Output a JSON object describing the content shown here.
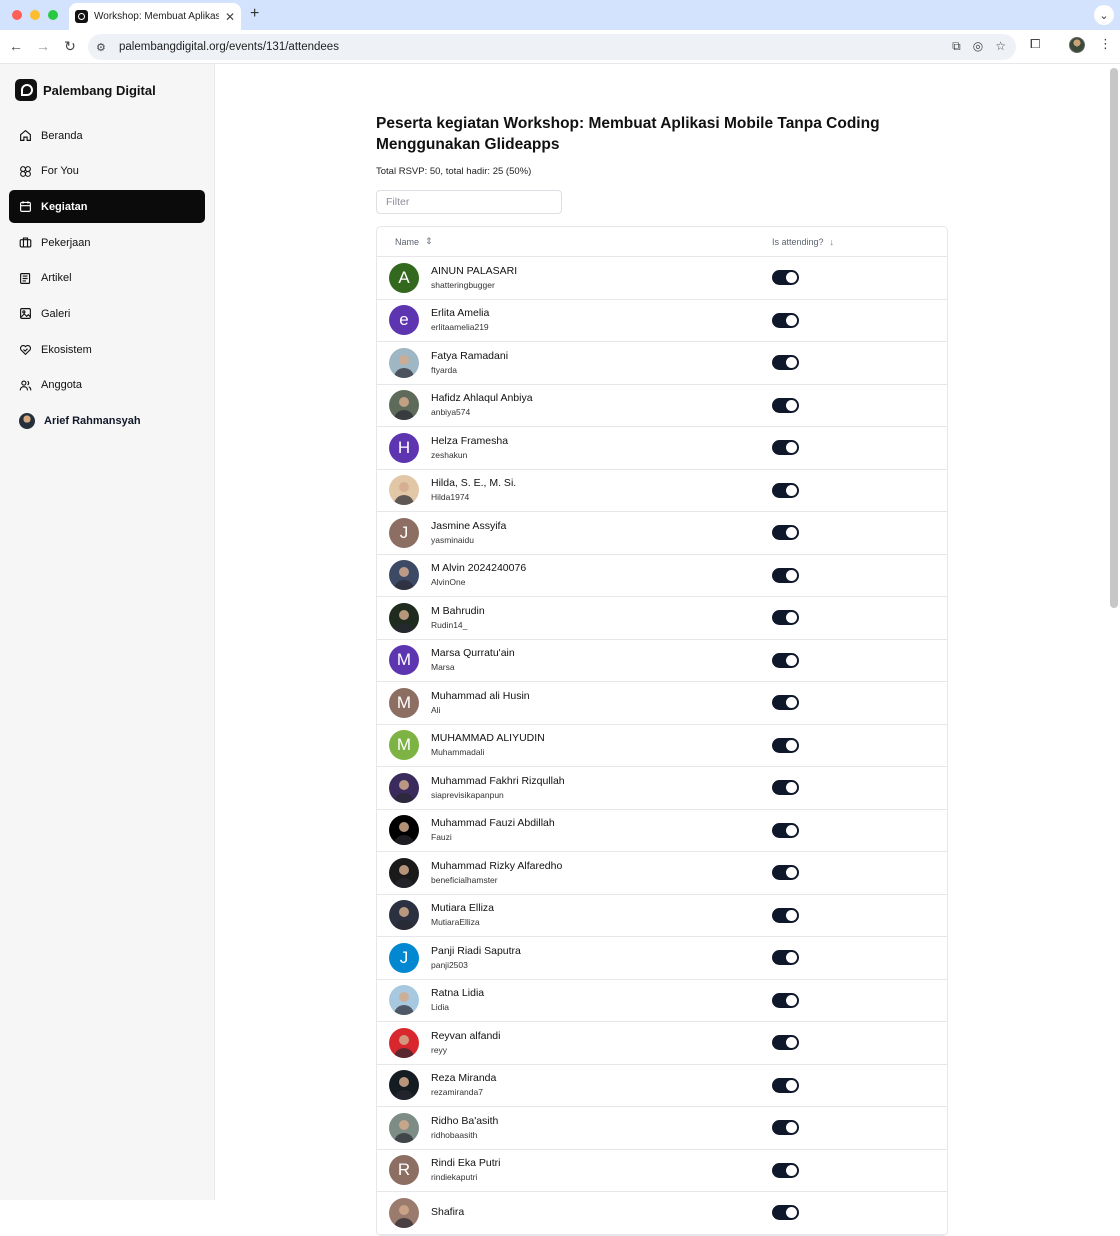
{
  "browser": {
    "tab_title": "Workshop: Membuat Aplikasi",
    "url": "palembangdigital.org/events/131/attendees",
    "traffic_colors": [
      "#ff5f57",
      "#febc2e",
      "#28c840"
    ]
  },
  "sidebar": {
    "brand": "Palembang Digital",
    "items": [
      {
        "label": "Beranda",
        "icon": "home-icon",
        "active": false
      },
      {
        "label": "For You",
        "icon": "sparkle-icon",
        "active": false
      },
      {
        "label": "Kegiatan",
        "icon": "calendar-icon",
        "active": true
      },
      {
        "label": "Pekerjaan",
        "icon": "briefcase-icon",
        "active": false
      },
      {
        "label": "Artikel",
        "icon": "newspaper-icon",
        "active": false
      },
      {
        "label": "Galeri",
        "icon": "image-icon",
        "active": false
      },
      {
        "label": "Ekosistem",
        "icon": "heart-handshake-icon",
        "active": false
      },
      {
        "label": "Anggota",
        "icon": "users-icon",
        "active": false
      }
    ],
    "user": "Arief Rahmansyah"
  },
  "main": {
    "title": "Peserta kegiatan Workshop: Membuat Aplikasi Mobile Tanpa Coding Menggunakan Glideapps",
    "summary": "Total RSVP: 50, total hadir: 25 (50%)",
    "filter_placeholder": "Filter",
    "columns": {
      "name": "Name",
      "attending": "Is attending?"
    }
  },
  "attendees": [
    {
      "name": "AINUN PALASARI",
      "username": "shatteringbugger",
      "initial": "A",
      "color": "#33691e",
      "attending": true
    },
    {
      "name": "Erlita Amelia",
      "username": "erlitaamelia219",
      "initial": "e",
      "color": "#5e35b1",
      "attending": true
    },
    {
      "name": "Fatya Ramadani",
      "username": "ftyarda",
      "initial": "",
      "color": "#9fb6c4",
      "attending": true
    },
    {
      "name": "Hafidz Ahlaqul Anbiya",
      "username": "anbiya574",
      "initial": "",
      "color": "#5f6b5a",
      "attending": true
    },
    {
      "name": "Helza Framesha",
      "username": "zeshakun",
      "initial": "H",
      "color": "#5e35b1",
      "attending": true
    },
    {
      "name": "Hilda, S. E., M. Si.",
      "username": "Hilda1974",
      "initial": "",
      "color": "#e2c7a6",
      "attending": true
    },
    {
      "name": "Jasmine Assyifa",
      "username": "yasminaidu",
      "initial": "J",
      "color": "#8d6e63",
      "attending": true
    },
    {
      "name": "M Alvin 2024240076",
      "username": "AlvinOne",
      "initial": "",
      "color": "#3d4a66",
      "attending": true
    },
    {
      "name": "M Bahrudin",
      "username": "Rudin14_",
      "initial": "",
      "color": "#1f2b1f",
      "attending": true
    },
    {
      "name": "Marsa Qurratu'ain",
      "username": "Marsa",
      "initial": "M",
      "color": "#5e35b1",
      "attending": true
    },
    {
      "name": "Muhammad ali Husin",
      "username": "Ali",
      "initial": "M",
      "color": "#8d6e63",
      "attending": true
    },
    {
      "name": "MUHAMMAD ALIYUDIN",
      "username": "Muhammadali",
      "initial": "M",
      "color": "#7cb342",
      "attending": true
    },
    {
      "name": "Muhammad Fakhri Rizqullah",
      "username": "siaprevisikapanpun",
      "initial": "",
      "color": "#3b2a5c",
      "attending": true
    },
    {
      "name": "Muhammad Fauzi Abdillah",
      "username": "Fauzi",
      "initial": "",
      "color": "#000000",
      "attending": true
    },
    {
      "name": "Muhammad Rizky Alfaredho",
      "username": "beneficialhamster",
      "initial": "",
      "color": "#1a1a1a",
      "attending": true
    },
    {
      "name": "Mutiara Elliza",
      "username": "MutiaraElliza",
      "initial": "",
      "color": "#2b3140",
      "attending": true
    },
    {
      "name": "Panji Riadi Saputra",
      "username": "panji2503",
      "initial": "J",
      "color": "#0288d1",
      "attending": true
    },
    {
      "name": "Ratna Lidia",
      "username": "Lidia",
      "initial": "",
      "color": "#a8c8e0",
      "attending": true
    },
    {
      "name": "Reyvan alfandi",
      "username": "reyy",
      "initial": "",
      "color": "#d8282e",
      "attending": true
    },
    {
      "name": "Reza Miranda",
      "username": "rezamiranda7",
      "initial": "",
      "color": "#141c22",
      "attending": true
    },
    {
      "name": "Ridho Ba'asith",
      "username": "ridhobaasith",
      "initial": "",
      "color": "#7e8c86",
      "attending": true
    },
    {
      "name": "Rindi Eka Putri",
      "username": "rindiekaputri",
      "initial": "R",
      "color": "#8d6e63",
      "attending": true
    },
    {
      "name": "Shafira",
      "username": "",
      "initial": "",
      "color": "#9b7b6d",
      "attending": true
    }
  ]
}
